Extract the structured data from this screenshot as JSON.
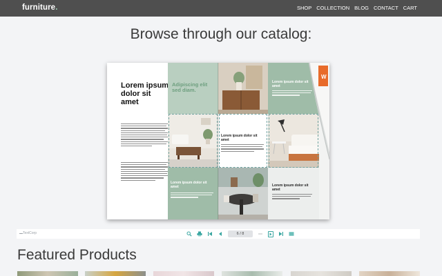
{
  "header": {
    "logo": "furniture",
    "logo_dot": ".",
    "nav": [
      "SHOP",
      "COLLECTION",
      "BLOG",
      "CONTACT",
      "CART"
    ]
  },
  "catalog": {
    "heading": "Browse through our catalog:",
    "left_title": "Lorem ipsum dolor sit amet",
    "green_heading": "Adipiscing elit sed diam.",
    "card_heading_1": "Lorem ipsum dolor sit amet",
    "card_heading_2": "Lorem ipsum dolor sit amet",
    "card_heading_3": "Lorem ipsum dolor sit amet",
    "card_heading_4": "Lorem ipsum dolor sit amet",
    "card_heading_5": "Lorem ipsum dolor sit amet",
    "badge": "W"
  },
  "viewer": {
    "brand": "TextCorp",
    "page_indicator": "6 / 8",
    "tools": [
      "search-icon",
      "print-icon",
      "first-page-icon",
      "prev-page-icon",
      "next-page-icon",
      "last-page-icon",
      "thumbnails-icon"
    ],
    "accent": "#3aa6a1"
  },
  "featured": {
    "heading": "Featured Products"
  }
}
